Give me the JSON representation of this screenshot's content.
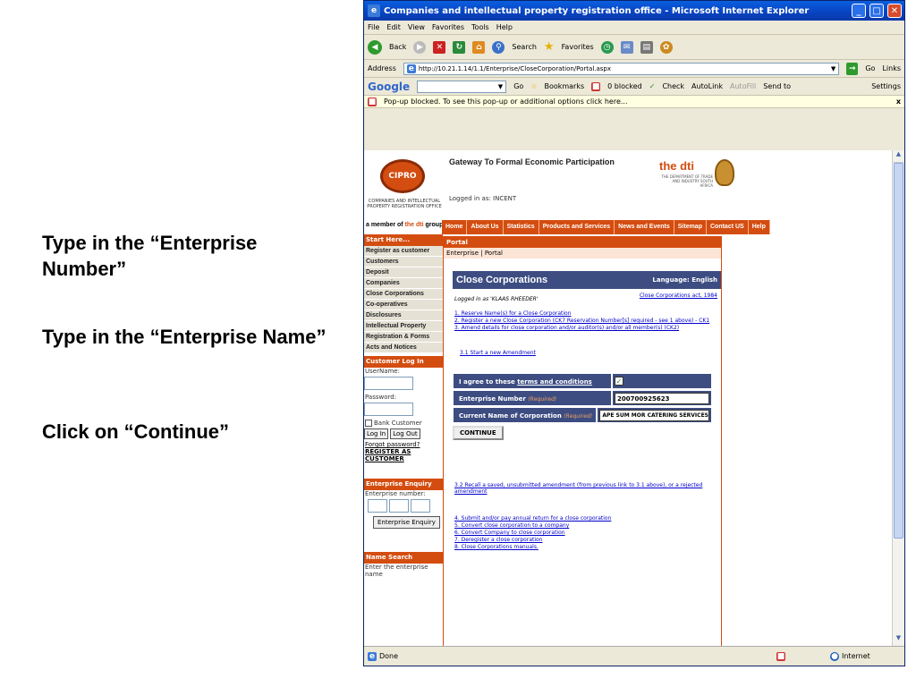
{
  "narration": {
    "step1": "Type in the “Enterprise Number”",
    "step2": "Type in the “Enterprise Name”",
    "step3": "Click on “Continue”"
  },
  "browser": {
    "title": "Companies and intellectual property registration office - Microsoft Internet Explorer",
    "menu": [
      "File",
      "Edit",
      "View",
      "Favorites",
      "Tools",
      "Help"
    ],
    "back": "Back",
    "search": "Search",
    "favorites": "Favorites",
    "address_label": "Address",
    "url": "http://10.21.1.14/1.1/Enterprise/CloseCorporation/Portal.aspx",
    "go": "Go",
    "links": "Links",
    "google_go": "Go",
    "bookmarks": "Bookmarks",
    "blocked": "0 blocked",
    "check": "Check",
    "autolink": "AutoLink",
    "autofill": "AutoFill",
    "send_to": "Send to",
    "settings": "Settings",
    "popup_msg": "Pop-up blocked. To see this pop-up or additional options click here...",
    "status_done": "Done",
    "status_zone": "Internet"
  },
  "site": {
    "logo": "CIPRO",
    "org": "COMPANIES AND INTELLECTUAL PROPERTY REGISTRATION OFFICE",
    "heading": "Gateway To Formal Economic Participation",
    "logged": "Logged in as: INCENT",
    "dti": "the dti",
    "dti_sub": "THE DEPARTMENT OF TRADE AND INDUSTRY SOUTH AFRICA",
    "member": "a member of",
    "member_dti": "the dti",
    "member_group": "group",
    "nav": [
      "Home",
      "About Us",
      "Statistics",
      "Products and Services",
      "News and Events",
      "Sitemap",
      "Contact US",
      "Help"
    ]
  },
  "sidebar": {
    "start": "Start Here...",
    "items": [
      "Register as customer",
      "Customers",
      "Deposit",
      "Companies",
      "Close Corporations",
      "Co-operatives",
      "Disclosures",
      "Intellectual Property",
      "Registration & Forms",
      "Acts and Notices"
    ],
    "login_head": "Customer Log In",
    "username": "UserName:",
    "password": "Password:",
    "bank": "Bank Customer",
    "login_btn": "Log In",
    "logout_btn": "Log Out",
    "forgot": "Forgot password?",
    "register": "REGISTER AS CUSTOMER",
    "enquiry_head": "Enterprise Enquiry",
    "enquiry_label": "Enterprise number:",
    "enquiry_btn": "Enterprise Enquiry",
    "name_head": "Name Search",
    "name_label": "Enter the enterprise name"
  },
  "main": {
    "portal": "Portal",
    "crumb": "Enterprise | Portal",
    "cc_title": "Close Corporations",
    "language": "Language: English",
    "logged_as": "Logged in as 'KLAAS RHEEDER'",
    "cc_act": "Close Corporations act, 1984",
    "links1": [
      "1. Reserve Name(s) for a Close Corporation",
      "2. Register a new Close Corporation (CK7 Reservation Number[s] required - see 1 above) - CK1",
      "3. Amend details for close corporation and/or auditor(s) and/or all member(s) (CK2)"
    ],
    "start_amend": "3.1 Start a new Amendment",
    "agree_pre": "I agree to these ",
    "agree_link": "terms and conditions",
    "en_label": "Enterprise Number",
    "required": "(Required)",
    "en_value": "200700925623",
    "name_label": "Current Name of Corporation",
    "name_value": "APE SUM MOR CATERING SERVICES",
    "continue": "CONTINUE",
    "recall": "3.2 Recall a saved, unsubmitted amendment (from previous link to 3.1 above), or a rejected amendment",
    "links2": [
      "4. Submit and/or pay annual return for a close corporation",
      "5. Convert close corporation to a company",
      "6. Convert Company to close corporation",
      "7. Deregister a close corporation",
      "8. Close Corporations manuals."
    ]
  },
  "colors": {
    "accent": "#d44d10",
    "form": "#3d4d82",
    "titlebar": "#0a5fe0"
  }
}
